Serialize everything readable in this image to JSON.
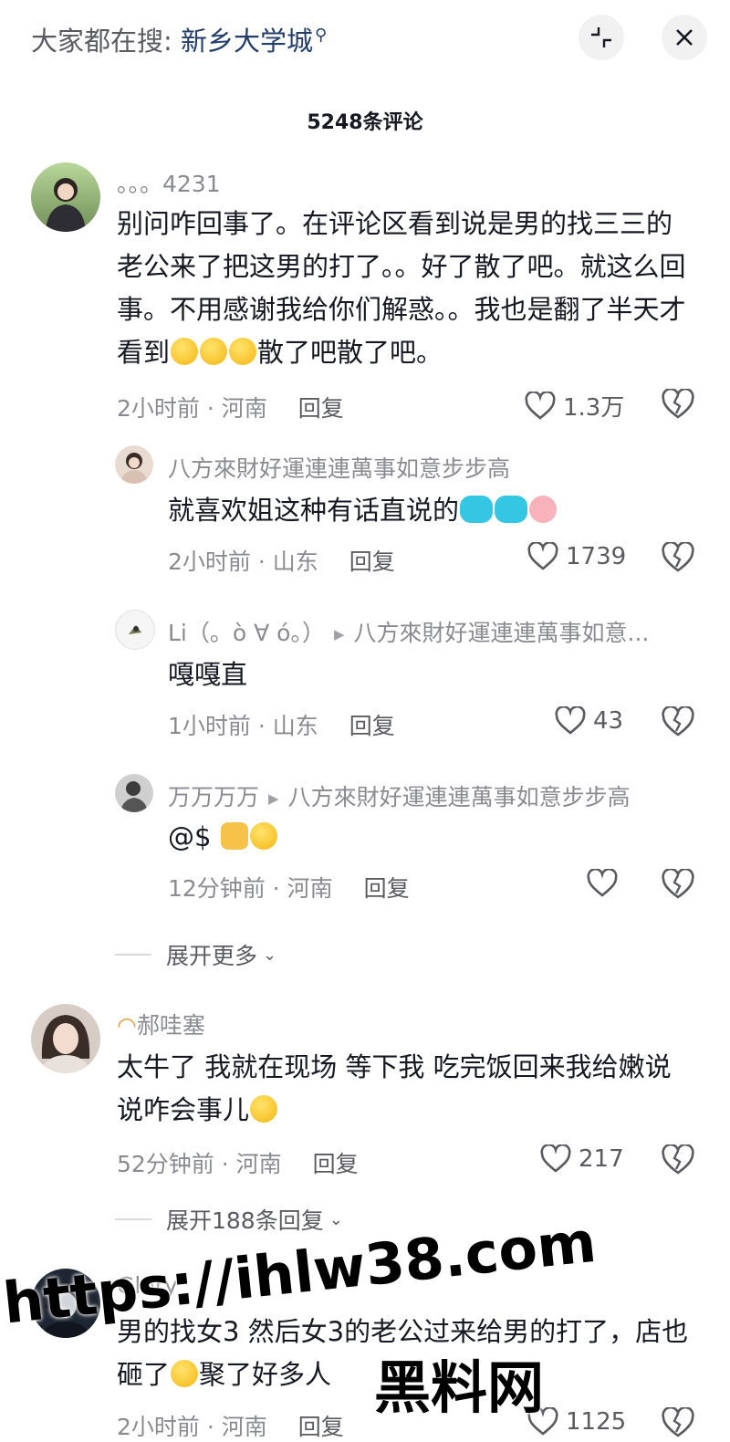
{
  "header": {
    "search_prefix": "大家都在搜:",
    "search_keyword": "新乡大学城",
    "search_icon": "search-icon",
    "collapse_icon": "minimize-icon",
    "close_icon": "close-icon"
  },
  "title": "5248条评论",
  "comments": [
    {
      "user": "。。。4231",
      "text": "别问咋回事了。在评论区看到说是男的找三三的老公来了把这男的打了。。好了散了吧。就这么回事。不用感谢我给你们解惑。。我也是翻了半天才看到",
      "text_tail": "散了吧散了吧。",
      "time": "2小时前",
      "location": "河南",
      "reply": "回复",
      "likes": "1.3万"
    },
    {
      "user": "八方來財好運連連萬事如意步步高",
      "text": "就喜欢姐这种有话直说的",
      "time": "2小时前",
      "location": "山东",
      "reply": "回复",
      "likes": "1739"
    },
    {
      "user": "Li（。ò ∀ ó。）",
      "reply_to": "八方來財好運連連萬事如意...",
      "text": "嘎嘎直",
      "time": "1小时前",
      "location": "山东",
      "reply": "回复",
      "likes": "43"
    },
    {
      "user": "万万万万",
      "reply_to": "八方來財好運連連萬事如意步步高",
      "text": "@$",
      "time": "12分钟前",
      "location": "河南",
      "reply": "回复",
      "likes": ""
    },
    {
      "user": "郝哇塞",
      "text": "太牛了 我就在现场 等下我 吃完饭回来我给嫩说说咋会事儿",
      "time": "52分钟前",
      "location": "河南",
      "reply": "回复",
      "likes": "217"
    },
    {
      "user": "Glory",
      "text": "男的找女3 然后女3的老公过来给男的打了，店也砸了",
      "text_tail": "聚了好多人",
      "time": "2小时前",
      "location": "河南",
      "reply": "回复",
      "likes": "1125"
    }
  ],
  "expand_more": "展开更多",
  "expand_replies": "展开188条回复",
  "watermark": {
    "url": "https://ihlw38.com",
    "text": "黑料网"
  },
  "colors": {
    "keyword": "#233d6b",
    "text": "#161823",
    "muted": "#8a8b91"
  }
}
